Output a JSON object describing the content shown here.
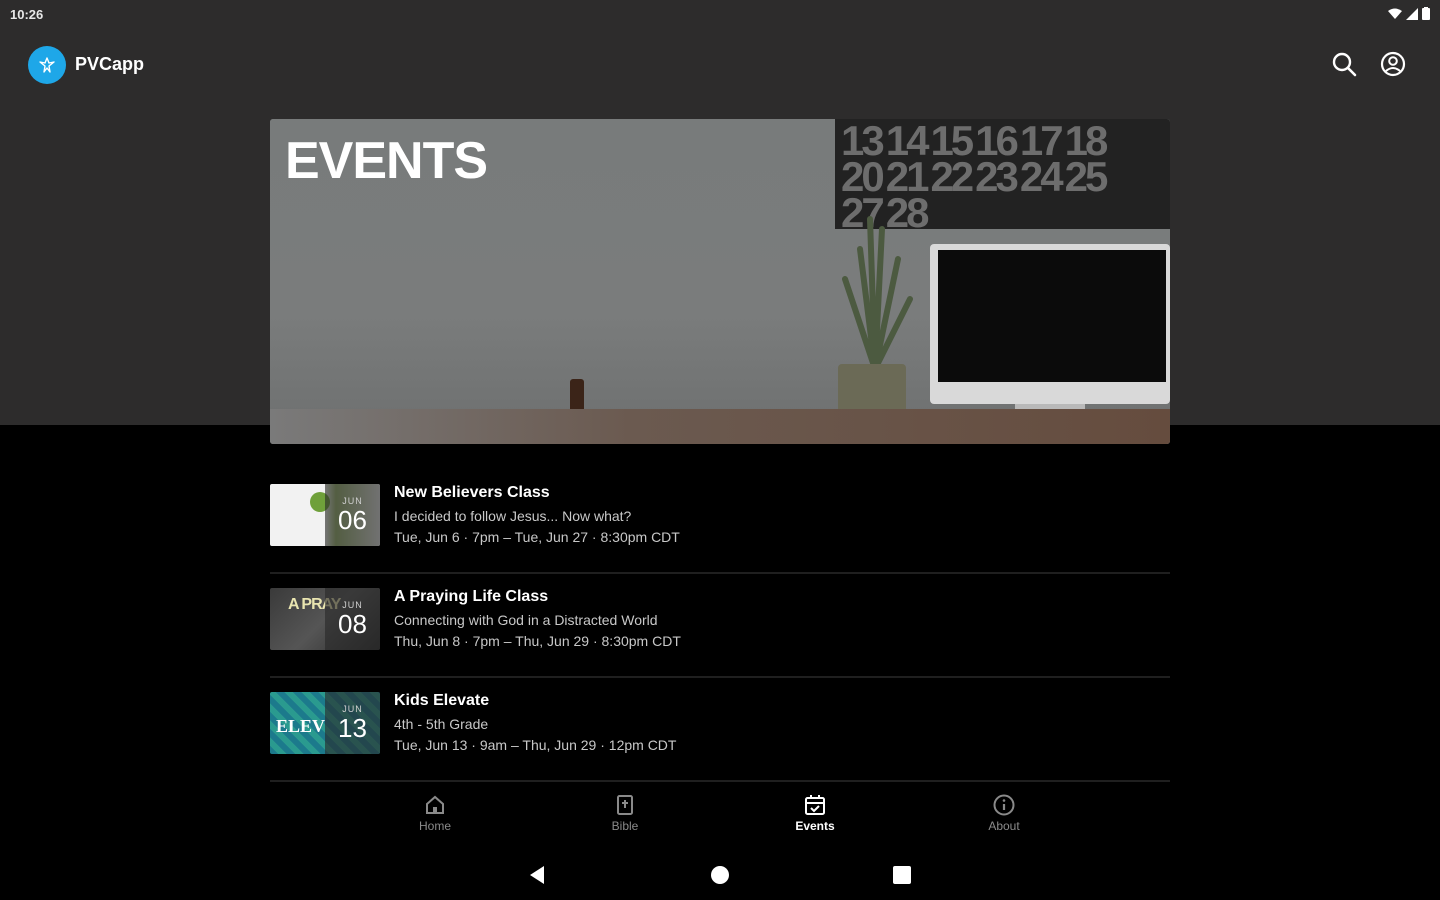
{
  "status_bar": {
    "time": "10:26"
  },
  "app_bar": {
    "title": "PVCapp"
  },
  "hero": {
    "title": "EVENTS",
    "calendar_rows": [
      [
        "13",
        "14",
        "15",
        "16",
        "17",
        "18"
      ],
      [
        "20",
        "21",
        "22",
        "23",
        "24",
        "25"
      ],
      [
        "27",
        "28"
      ]
    ]
  },
  "events": [
    {
      "title": "New Believers Class",
      "subtitle": "I decided to follow Jesus... Now what?",
      "time": "Tue, Jun 6 · 7pm – Tue, Jun 27 · 8:30pm CDT",
      "month": "JUN",
      "day": "06"
    },
    {
      "title": "A Praying Life Class",
      "subtitle": "Connecting with God in a Distracted World",
      "time": "Thu, Jun 8 · 7pm – Thu, Jun 29 · 8:30pm CDT",
      "month": "JUN",
      "day": "08",
      "thumb_text": "A PRAY"
    },
    {
      "title": "Kids Elevate",
      "subtitle": "4th - 5th Grade",
      "time": "Tue, Jun 13 · 9am – Thu, Jun 29 · 12pm CDT",
      "month": "JUN",
      "day": "13",
      "thumb_text": "ELEV"
    }
  ],
  "bottom_nav": [
    {
      "label": "Home",
      "icon": "home-icon"
    },
    {
      "label": "Bible",
      "icon": "bible-icon"
    },
    {
      "label": "Events",
      "icon": "calendar-icon",
      "active": true
    },
    {
      "label": "About",
      "icon": "info-icon"
    }
  ],
  "colors": {
    "accent": "#1ea7e8",
    "header_bg": "#2d2c2c",
    "page_bg": "#000000"
  }
}
